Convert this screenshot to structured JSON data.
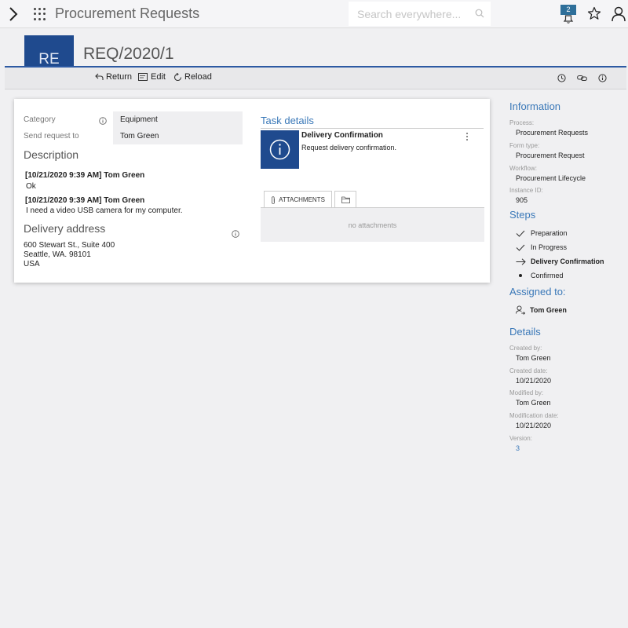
{
  "topbar": {
    "title": "Procurement Requests",
    "search_placeholder": "Search everywhere...",
    "notification_count": "2"
  },
  "header": {
    "avatar_initials": "RE",
    "request_id": "REQ/2020/1"
  },
  "toolbar": {
    "return_label": "Return",
    "edit_label": "Edit",
    "reload_label": "Reload"
  },
  "form": {
    "category_label": "Category",
    "category_value": "Equipment",
    "send_to_label": "Send request to",
    "send_to_value": "Tom Green",
    "description_title": "Description",
    "comments": [
      {
        "header": "[10/21/2020 9:39 AM] Tom Green",
        "body": "Ok"
      },
      {
        "header": "[10/21/2020 9:39 AM] Tom Green",
        "body": "I need a video USB camera for my computer."
      }
    ],
    "delivery_title": "Delivery address",
    "address_lines": [
      "600 Stewart St., Suite 400",
      "Seattle, WA. 98101",
      "USA"
    ]
  },
  "task": {
    "title": "Task details",
    "name": "Delivery Confirmation",
    "description": "Request delivery confirmation.",
    "attachments_tab": "ATTACHMENTS",
    "no_attachments": "no attachments"
  },
  "info": {
    "heading": "Information",
    "process_label": "Process:",
    "process_value": "Procurement Requests",
    "form_type_label": "Form type:",
    "form_type_value": "Procurement Request",
    "workflow_label": "Workflow:",
    "workflow_value": "Procurement Lifecycle",
    "instance_label": "Instance ID:",
    "instance_value": "905"
  },
  "steps": {
    "heading": "Steps",
    "items": [
      {
        "label": "Preparation",
        "state": "done"
      },
      {
        "label": "In Progress",
        "state": "done"
      },
      {
        "label": "Delivery Confirmation",
        "state": "current"
      },
      {
        "label": "Confirmed",
        "state": "pending"
      }
    ]
  },
  "assigned": {
    "heading": "Assigned to:",
    "name": "Tom Green"
  },
  "details": {
    "heading": "Details",
    "created_by_label": "Created by:",
    "created_by_value": "Tom Green",
    "created_date_label": "Created date:",
    "created_date_value": "10/21/2020",
    "modified_by_label": "Modified by:",
    "modified_by_value": "Tom Green",
    "modification_date_label": "Modification date:",
    "modification_date_value": "10/21/2020",
    "version_label": "Version:",
    "version_value": "3"
  },
  "colors": {
    "accent": "#1f4a8e",
    "link": "#3a78b8",
    "badge": "#2e6f9a"
  }
}
